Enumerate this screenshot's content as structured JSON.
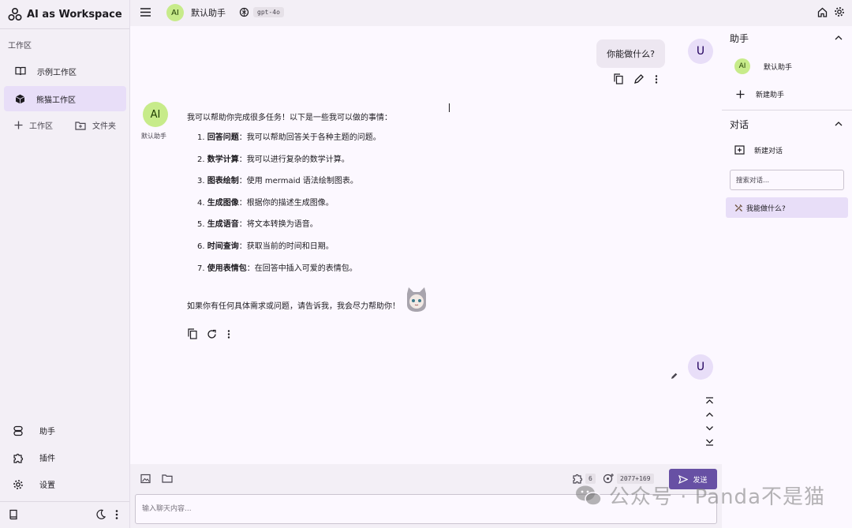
{
  "app": {
    "title": "AI as Workspace"
  },
  "left_sidebar": {
    "section_label": "工作区",
    "workspaces": [
      {
        "label": "示例工作区",
        "icon": "book-icon",
        "active": false
      },
      {
        "label": "熊猫工作区",
        "icon": "cube-icon",
        "active": true
      }
    ],
    "add_workspace_label": "工作区",
    "add_folder_label": "文件夹",
    "bottom": [
      {
        "label": "助手",
        "icon": "assistant-icon"
      },
      {
        "label": "插件",
        "icon": "puzzle-icon"
      },
      {
        "label": "设置",
        "icon": "gear-icon"
      }
    ]
  },
  "header": {
    "assistant_avatar": "AI",
    "assistant_name": "默认助手",
    "model": "gpt-4o"
  },
  "chat": {
    "user_avatar": "U",
    "user_message": "你能做什么?",
    "ai_avatar": "AI",
    "ai_name": "默认助手",
    "intro": "我可以帮助你完成很多任务！以下是一些我可以做的事情：",
    "items": [
      {
        "num": "1.",
        "title": "回答问题",
        "desc": "：我可以帮助回答关于各种主题的问题。"
      },
      {
        "num": "2.",
        "title": "数学计算",
        "desc": "：我可以进行复杂的数学计算。"
      },
      {
        "num": "3.",
        "title": "图表绘制",
        "desc": "：使用 mermaid 语法绘制图表。"
      },
      {
        "num": "4.",
        "title": "生成图像",
        "desc": "：根据你的描述生成图像。"
      },
      {
        "num": "5.",
        "title": "生成语音",
        "desc": "：将文本转换为语音。"
      },
      {
        "num": "6.",
        "title": "时间查询",
        "desc": "：获取当前的时间和日期。"
      },
      {
        "num": "7.",
        "title": "使用表情包",
        "desc": "：在回答中插入可爱的表情包。"
      }
    ],
    "outro": "如果你有任何具体需求或问题，请告诉我，我会尽力帮助你！"
  },
  "input": {
    "placeholder": "输入聊天内容...",
    "plugin_count": "6",
    "token_count": "2077+169",
    "send_label": "发送"
  },
  "right_sidebar": {
    "assistant_heading": "助手",
    "assistant_avatar": "AI",
    "default_assistant": "默认助手",
    "new_assistant": "新建助手",
    "conversation_heading": "对话",
    "new_conversation": "新建对话",
    "search_placeholder": "搜索对话...",
    "active_conversation": "我能做什么?"
  },
  "watermark": "公众号 · Panda不是猫",
  "colors": {
    "accent": "#6750a4",
    "active_bg": "#e8def8",
    "ai_avatar": "#c7eb8a"
  }
}
